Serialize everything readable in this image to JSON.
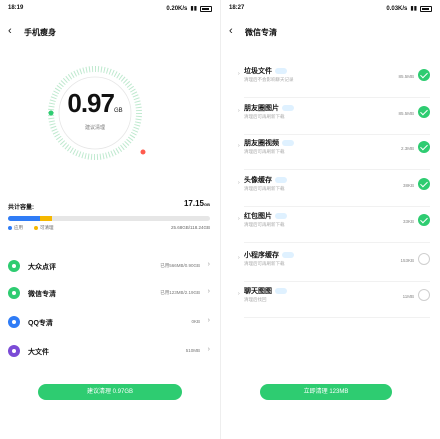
{
  "left": {
    "status": {
      "time": "18:19",
      "net": "0.20K/s"
    },
    "title": "手机瘦身",
    "gauge": {
      "value": "0.97",
      "unit": "GB",
      "sub_label": "建议清理"
    },
    "storage": {
      "label": "共计容量:",
      "total": "17.15",
      "total_unit": "GB",
      "legend": [
        {
          "label": "应用",
          "color": "#2f7cf6"
        },
        {
          "label": "可清理",
          "color": "#f5b800"
        }
      ],
      "used_summary": "25.68GB/118.24GB",
      "segments": [
        0.16,
        0.06
      ]
    },
    "apps": [
      {
        "name": "大众点评",
        "size": "已用566MB/0.90GB",
        "color": "#2ecc71"
      },
      {
        "name": "微信专清",
        "size": "已用123MB/2.19GB",
        "color": "#2ecc71"
      },
      {
        "name": "QQ专清",
        "size": "0KB",
        "color": "#2f7cf6"
      },
      {
        "name": "大文件",
        "size": "510MB",
        "color": "#7b4bd6"
      }
    ],
    "cta": "建议清理 0.97GB"
  },
  "right": {
    "status": {
      "time": "18:27",
      "net": "0.03K/s"
    },
    "title": "微信专清",
    "items": [
      {
        "name": "垃圾文件",
        "desc": "清理后不会影响聊天记录",
        "size": "85.5MB",
        "checked": true
      },
      {
        "name": "朋友圈图片",
        "desc": "清理后可再刷新下载",
        "size": "85.5MB",
        "checked": true
      },
      {
        "name": "朋友圈视频",
        "desc": "清理后可再刷新下载",
        "size": "2.3MB",
        "checked": true
      },
      {
        "name": "头像缓存",
        "desc": "清理后可再刷新下载",
        "size": "38KB",
        "checked": true
      },
      {
        "name": "红包图片",
        "desc": "清理后可再刷新下载",
        "size": "33KB",
        "checked": true
      },
      {
        "name": "小程序缓存",
        "desc": "清理后可再刷新下载",
        "size": "153KB",
        "checked": false
      },
      {
        "name": "聊天图图",
        "desc": "清理后找回",
        "size": "11MB",
        "checked": false
      }
    ],
    "cta": "立即清理 123MB"
  },
  "icons": {
    "back": "‹",
    "expand": "›",
    "chevron": "›"
  },
  "colors": {
    "accent": "#2ecc71",
    "blue": "#2f7cf6",
    "yellow": "#f5b800"
  }
}
